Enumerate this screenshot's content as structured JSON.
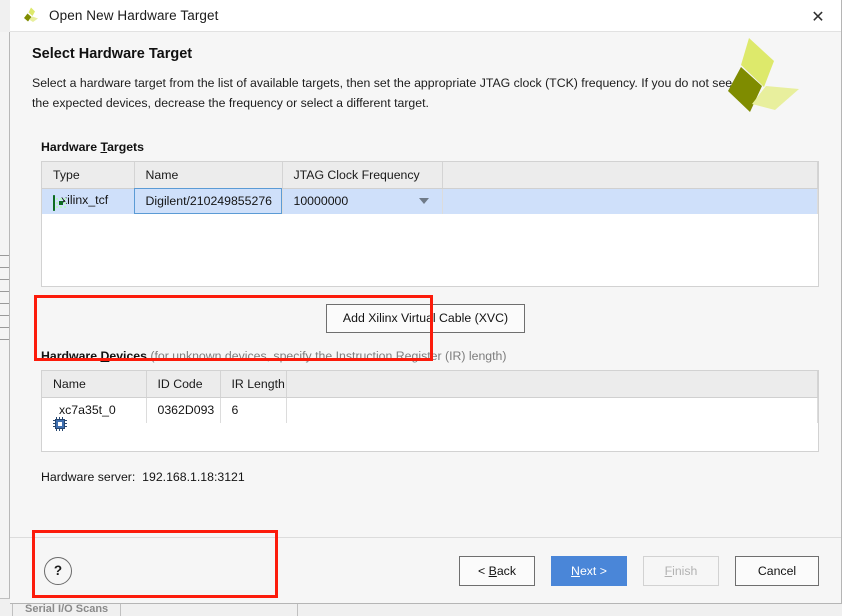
{
  "window": {
    "title": "Open New Hardware Target",
    "icon": "xilinx-logo-icon",
    "close_icon": "✕"
  },
  "header": {
    "title": "Select Hardware Target",
    "description": "Select a hardware target from the list of available targets, then set the appropriate JTAG clock (TCK) frequency. If you do not see the expected devices, decrease the frequency or select a different target.",
    "logo": "xilinx-logo"
  },
  "targets_section": {
    "label_pre": "Hardware ",
    "label_underlined": "T",
    "label_post": "argets",
    "columns": [
      "Type",
      "Name",
      "JTAG Clock Frequency"
    ],
    "rows": [
      {
        "type": "xilinx_tcf",
        "type_icon": "tcf-chip-icon",
        "name": "Digilent/210249855276",
        "frequency": "10000000",
        "frequency_arrow": "chevron-down-icon"
      }
    ]
  },
  "xvc_button": {
    "label": "Add Xilinx Virtual Cable (XVC)"
  },
  "devices_section": {
    "label_pre": "Hardware ",
    "label_underlined": "D",
    "label_post": "evices",
    "label_hint": " (for unknown devices, specify the Instruction Register (IR) length)",
    "columns": [
      "Name",
      "ID Code",
      "IR Length"
    ],
    "rows": [
      {
        "name": "xc7a35t_0",
        "name_icon": "fpga-chip-icon",
        "id_code": "0362D093",
        "ir_length": "6"
      }
    ]
  },
  "hardware_server": {
    "label": "Hardware server:",
    "value": "192.168.1.18:3121"
  },
  "footer": {
    "help_label": "?",
    "back_pre": "< ",
    "back_underlined": "B",
    "back_post": "ack",
    "next_underlined": "N",
    "next_post": "ext >",
    "finish_underlined": "F",
    "finish_post": "inish",
    "cancel_label": "Cancel"
  },
  "background": {
    "tab_label": "Serial I/O Scans"
  },
  "colors": {
    "accent_blue": "#4a86d8",
    "selection_blue": "#cfe0fa",
    "annotation_red": "#fc1b0b",
    "xilinx_green_light": "#dde96b",
    "xilinx_green_dark": "#7f8c00",
    "xilinx_green_pale": "#e8ef9d"
  }
}
